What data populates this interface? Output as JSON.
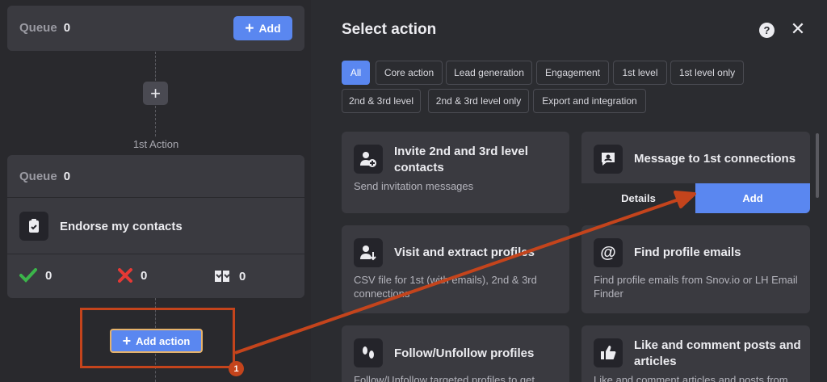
{
  "workflow": {
    "top_card": {
      "queue_label": "Queue",
      "queue_count": "0",
      "add_label": "Add"
    },
    "first_action_label": "1st Action",
    "action_card": {
      "queue_label": "Queue",
      "queue_count": "0",
      "task_name": "Endorse my contacts",
      "stats": {
        "success": "0",
        "failed": "0",
        "skipped": "0"
      }
    },
    "add_action_label": "Add action",
    "step_badge": "1"
  },
  "panel": {
    "title": "Select action",
    "filters": [
      "All",
      "Core action",
      "Lead generation",
      "Engagement",
      "1st level",
      "1st level only",
      "2nd & 3rd level",
      "2nd & 3rd level only",
      "Export and integration"
    ],
    "active_filter": "All",
    "cards": [
      {
        "title": "Invite 2nd and 3rd level contacts",
        "desc": "Send invitation messages",
        "icon": "invite-user-icon"
      },
      {
        "title": "Message to 1st connections",
        "desc": "",
        "icon": "message-icon",
        "details_label": "Details",
        "add_label": "Add"
      },
      {
        "title": "Visit and extract profiles",
        "desc": "CSV file for 1st (with emails), 2nd & 3rd connections",
        "icon": "extract-user-icon"
      },
      {
        "title": "Find profile emails",
        "desc": "Find profile emails from Snov.io or LH Email Finder",
        "icon": "at-sign-icon"
      },
      {
        "title": "Follow/Unfollow profiles",
        "desc": "Follow/Unfollow targeted profiles to get",
        "icon": "footsteps-icon"
      },
      {
        "title": "Like and comment posts and articles",
        "desc": "Like and comment articles and posts from",
        "icon": "thumbs-up-icon"
      }
    ]
  },
  "colors": {
    "accent": "#5a87f0",
    "annotation": "#c4441c",
    "success": "#3bb54a",
    "error": "#e53935"
  }
}
